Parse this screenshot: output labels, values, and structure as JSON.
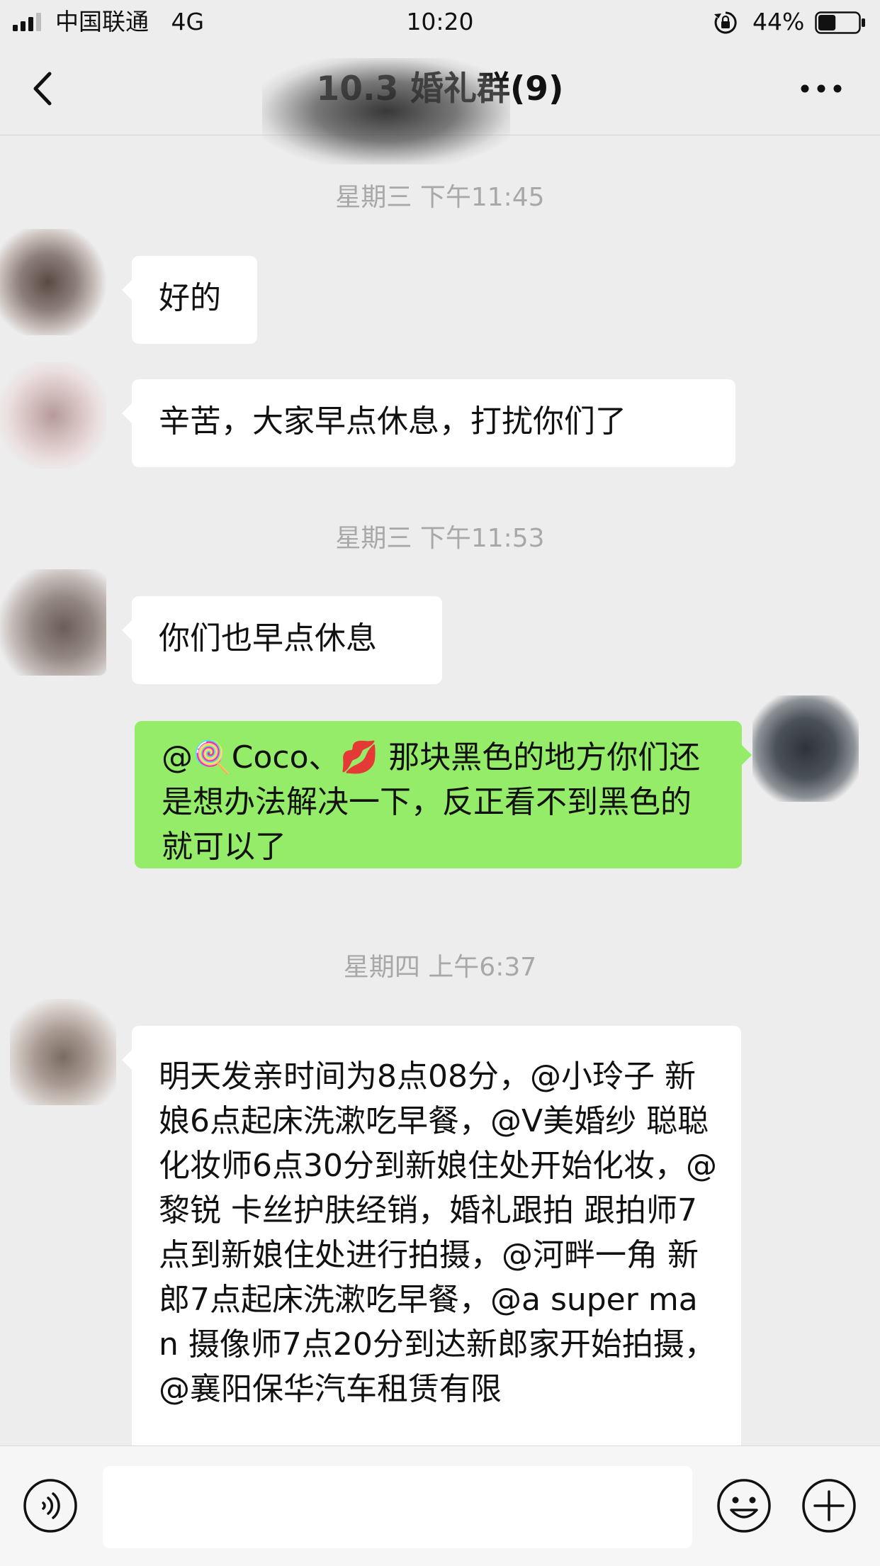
{
  "status_bar": {
    "carrier": "中国联通",
    "network": "4G",
    "time": "10:20",
    "battery_percent": "44%",
    "battery_level": 0.44
  },
  "nav": {
    "title": "10.3 婚礼群(9)"
  },
  "messages": [
    {
      "type": "timestamp",
      "text": "星期三 下午11:45"
    },
    {
      "type": "incoming",
      "text": "好的"
    },
    {
      "type": "incoming",
      "text": "辛苦，大家早点休息，打扰你们了"
    },
    {
      "type": "timestamp",
      "text": "星期三 下午11:53"
    },
    {
      "type": "incoming",
      "text": "你们也早点休息"
    },
    {
      "type": "outgoing",
      "text": "@🍭Coco、💋 那块黑色的地方你们还是想办法解决一下，反正看不到黑色的就可以了"
    },
    {
      "type": "timestamp",
      "text": "星期四 上午6:37"
    },
    {
      "type": "incoming",
      "text": "明天发亲时间为8点08分，@小玲子 新娘6点起床洗漱吃早餐，@V美婚纱 聪聪 化妆师6点30分到新娘住处开始化妆，@黎锐 卡丝护肤经销，婚礼跟拍 跟拍师7点到新娘住处进行拍摄，@河畔一角 新郎7点起床洗漱吃早餐，@a super man 摄像师7点20分到达新郎家开始拍摄，@襄阳保华汽车租赁有限"
    }
  ],
  "input_bar": {
    "placeholder": ""
  },
  "colors": {
    "background": "#ededed",
    "incoming_bubble": "#ffffff",
    "outgoing_bubble": "#95ec69",
    "timestamp_text": "#a8a8a8"
  },
  "icons": [
    "signal-icon",
    "rotation-lock-icon",
    "battery-icon",
    "back-icon",
    "more-icon",
    "voice-icon",
    "emoji-icon",
    "plus-icon"
  ]
}
